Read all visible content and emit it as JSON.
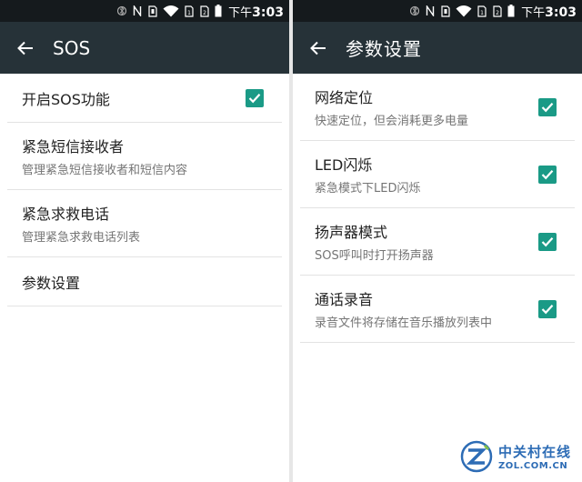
{
  "status_bar": {
    "time_prefix": "下午",
    "time": "3:03",
    "icons": [
      "bluetooth-icon",
      "nfc-icon",
      "sim-icon",
      "wifi-icon",
      "sim1-icon",
      "sim2-icon",
      "battery-icon"
    ]
  },
  "left_screen": {
    "title": "SOS",
    "items": [
      {
        "title": "开启SOS功能",
        "subtitle": "",
        "checked": true
      },
      {
        "title": "紧急短信接收者",
        "subtitle": "管理紧急短信接收者和短信内容"
      },
      {
        "title": "紧急求救电话",
        "subtitle": "管理紧急求救电话列表"
      },
      {
        "title": "参数设置",
        "subtitle": ""
      }
    ]
  },
  "right_screen": {
    "title": "参数设置",
    "items": [
      {
        "title": "网络定位",
        "subtitle": "快速定位，但会消耗更多电量",
        "checked": true
      },
      {
        "title": "LED闪烁",
        "subtitle": "紧急模式下LED闪烁",
        "checked": true
      },
      {
        "title": "扬声器模式",
        "subtitle": "SOS呼叫时打开扬声器",
        "checked": true
      },
      {
        "title": "通话录音",
        "subtitle": "录音文件将存储在音乐播放列表中",
        "checked": true
      }
    ]
  },
  "colors": {
    "status_bar": "#151a1d",
    "app_bar": "#263238",
    "checkbox": "#1a9a86",
    "watermark": "#2d6cb5"
  },
  "watermark": {
    "cn": "中关村在线",
    "en": "ZOL.COM.CN"
  }
}
